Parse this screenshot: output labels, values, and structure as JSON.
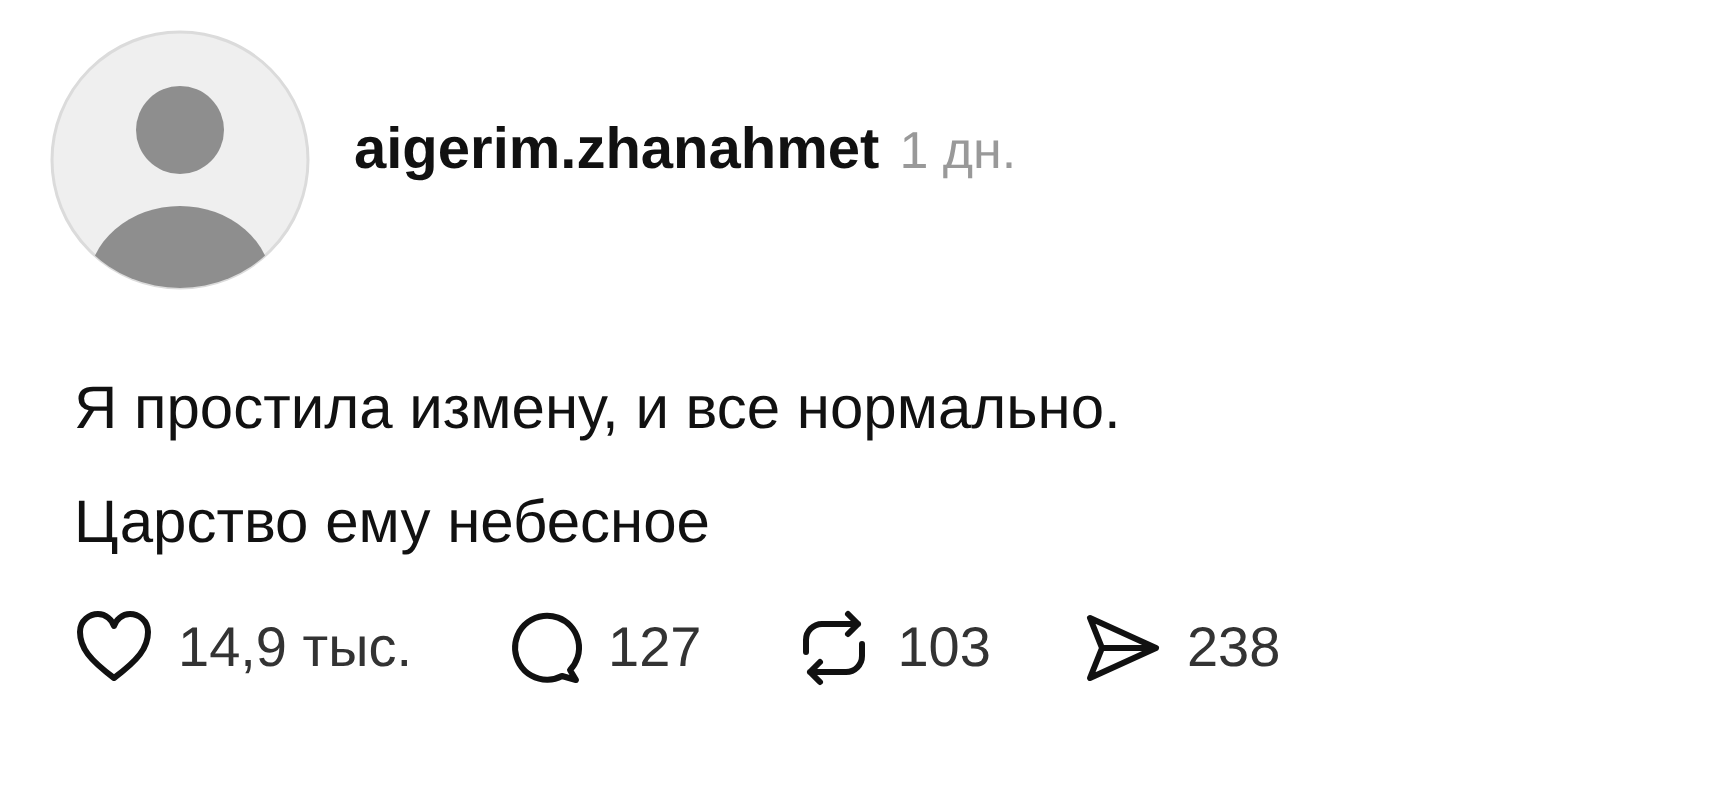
{
  "post": {
    "username": "aigerim.zhanahmet",
    "time": "1 дн.",
    "lines": [
      "Я простила измену, и все нормально.",
      "Царство ему небесное"
    ],
    "actions": [
      {
        "kind": "like",
        "count": "14,9 тыс."
      },
      {
        "kind": "comment",
        "count": "127"
      },
      {
        "kind": "repost",
        "count": "103"
      },
      {
        "kind": "share",
        "count": "238"
      }
    ]
  }
}
